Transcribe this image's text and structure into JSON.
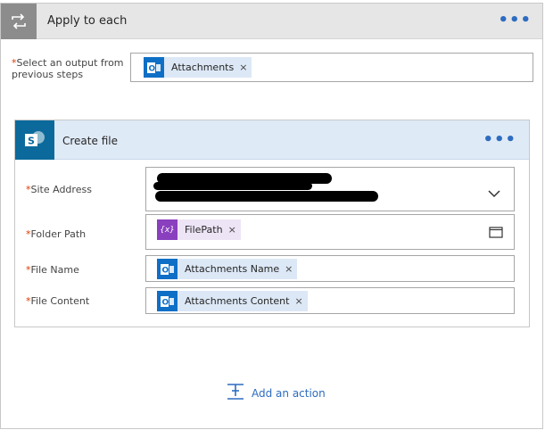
{
  "loop": {
    "title": "Apply to each",
    "more_label": "•••",
    "select_label_required": "*",
    "select_label_text": "Select an output from previous steps",
    "select_token": {
      "icon": "outlook-icon",
      "text": "Attachments",
      "remove": "×"
    }
  },
  "action": {
    "title": "Create file",
    "more_label": "•••",
    "fields": [
      {
        "required": "*",
        "label": "Site Address",
        "value_redacted": true
      },
      {
        "required": "*",
        "label": "Folder Path",
        "token": {
          "icon": "expression-icon",
          "icon_text": "{x}",
          "text": "FilePath",
          "remove": "×"
        }
      },
      {
        "required": "*",
        "label": "File Name",
        "token": {
          "icon": "outlook-icon",
          "text": "Attachments Name",
          "remove": "×"
        }
      },
      {
        "required": "*",
        "label": "File Content",
        "token": {
          "icon": "outlook-icon",
          "text": "Attachments Content",
          "remove": "×"
        }
      }
    ]
  },
  "add_action": {
    "label": "Add an action",
    "icon": "add-action-icon"
  },
  "colors": {
    "accent": "#2d6cc0",
    "outlook": "#0f6fc6",
    "sharepoint": "#0b6a9b",
    "expression": "#8a3fbf",
    "required": "#d83b01"
  }
}
